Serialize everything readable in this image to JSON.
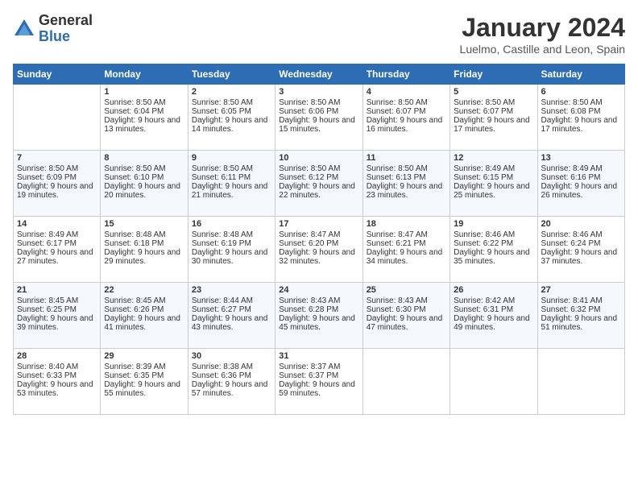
{
  "logo": {
    "general": "General",
    "blue": "Blue"
  },
  "title": "January 2024",
  "location": "Luelmo, Castille and Leon, Spain",
  "days": [
    "Sunday",
    "Monday",
    "Tuesday",
    "Wednesday",
    "Thursday",
    "Friday",
    "Saturday"
  ],
  "weeks": [
    [
      {
        "num": "",
        "data": []
      },
      {
        "num": "1",
        "sunrise": "Sunrise: 8:50 AM",
        "sunset": "Sunset: 6:04 PM",
        "daylight": "Daylight: 9 hours and 13 minutes."
      },
      {
        "num": "2",
        "sunrise": "Sunrise: 8:50 AM",
        "sunset": "Sunset: 6:05 PM",
        "daylight": "Daylight: 9 hours and 14 minutes."
      },
      {
        "num": "3",
        "sunrise": "Sunrise: 8:50 AM",
        "sunset": "Sunset: 6:06 PM",
        "daylight": "Daylight: 9 hours and 15 minutes."
      },
      {
        "num": "4",
        "sunrise": "Sunrise: 8:50 AM",
        "sunset": "Sunset: 6:07 PM",
        "daylight": "Daylight: 9 hours and 16 minutes."
      },
      {
        "num": "5",
        "sunrise": "Sunrise: 8:50 AM",
        "sunset": "Sunset: 6:07 PM",
        "daylight": "Daylight: 9 hours and 17 minutes."
      },
      {
        "num": "6",
        "sunrise": "Sunrise: 8:50 AM",
        "sunset": "Sunset: 6:08 PM",
        "daylight": "Daylight: 9 hours and 17 minutes."
      }
    ],
    [
      {
        "num": "7",
        "sunrise": "Sunrise: 8:50 AM",
        "sunset": "Sunset: 6:09 PM",
        "daylight": "Daylight: 9 hours and 19 minutes."
      },
      {
        "num": "8",
        "sunrise": "Sunrise: 8:50 AM",
        "sunset": "Sunset: 6:10 PM",
        "daylight": "Daylight: 9 hours and 20 minutes."
      },
      {
        "num": "9",
        "sunrise": "Sunrise: 8:50 AM",
        "sunset": "Sunset: 6:11 PM",
        "daylight": "Daylight: 9 hours and 21 minutes."
      },
      {
        "num": "10",
        "sunrise": "Sunrise: 8:50 AM",
        "sunset": "Sunset: 6:12 PM",
        "daylight": "Daylight: 9 hours and 22 minutes."
      },
      {
        "num": "11",
        "sunrise": "Sunrise: 8:50 AM",
        "sunset": "Sunset: 6:13 PM",
        "daylight": "Daylight: 9 hours and 23 minutes."
      },
      {
        "num": "12",
        "sunrise": "Sunrise: 8:49 AM",
        "sunset": "Sunset: 6:15 PM",
        "daylight": "Daylight: 9 hours and 25 minutes."
      },
      {
        "num": "13",
        "sunrise": "Sunrise: 8:49 AM",
        "sunset": "Sunset: 6:16 PM",
        "daylight": "Daylight: 9 hours and 26 minutes."
      }
    ],
    [
      {
        "num": "14",
        "sunrise": "Sunrise: 8:49 AM",
        "sunset": "Sunset: 6:17 PM",
        "daylight": "Daylight: 9 hours and 27 minutes."
      },
      {
        "num": "15",
        "sunrise": "Sunrise: 8:48 AM",
        "sunset": "Sunset: 6:18 PM",
        "daylight": "Daylight: 9 hours and 29 minutes."
      },
      {
        "num": "16",
        "sunrise": "Sunrise: 8:48 AM",
        "sunset": "Sunset: 6:19 PM",
        "daylight": "Daylight: 9 hours and 30 minutes."
      },
      {
        "num": "17",
        "sunrise": "Sunrise: 8:47 AM",
        "sunset": "Sunset: 6:20 PM",
        "daylight": "Daylight: 9 hours and 32 minutes."
      },
      {
        "num": "18",
        "sunrise": "Sunrise: 8:47 AM",
        "sunset": "Sunset: 6:21 PM",
        "daylight": "Daylight: 9 hours and 34 minutes."
      },
      {
        "num": "19",
        "sunrise": "Sunrise: 8:46 AM",
        "sunset": "Sunset: 6:22 PM",
        "daylight": "Daylight: 9 hours and 35 minutes."
      },
      {
        "num": "20",
        "sunrise": "Sunrise: 8:46 AM",
        "sunset": "Sunset: 6:24 PM",
        "daylight": "Daylight: 9 hours and 37 minutes."
      }
    ],
    [
      {
        "num": "21",
        "sunrise": "Sunrise: 8:45 AM",
        "sunset": "Sunset: 6:25 PM",
        "daylight": "Daylight: 9 hours and 39 minutes."
      },
      {
        "num": "22",
        "sunrise": "Sunrise: 8:45 AM",
        "sunset": "Sunset: 6:26 PM",
        "daylight": "Daylight: 9 hours and 41 minutes."
      },
      {
        "num": "23",
        "sunrise": "Sunrise: 8:44 AM",
        "sunset": "Sunset: 6:27 PM",
        "daylight": "Daylight: 9 hours and 43 minutes."
      },
      {
        "num": "24",
        "sunrise": "Sunrise: 8:43 AM",
        "sunset": "Sunset: 6:28 PM",
        "daylight": "Daylight: 9 hours and 45 minutes."
      },
      {
        "num": "25",
        "sunrise": "Sunrise: 8:43 AM",
        "sunset": "Sunset: 6:30 PM",
        "daylight": "Daylight: 9 hours and 47 minutes."
      },
      {
        "num": "26",
        "sunrise": "Sunrise: 8:42 AM",
        "sunset": "Sunset: 6:31 PM",
        "daylight": "Daylight: 9 hours and 49 minutes."
      },
      {
        "num": "27",
        "sunrise": "Sunrise: 8:41 AM",
        "sunset": "Sunset: 6:32 PM",
        "daylight": "Daylight: 9 hours and 51 minutes."
      }
    ],
    [
      {
        "num": "28",
        "sunrise": "Sunrise: 8:40 AM",
        "sunset": "Sunset: 6:33 PM",
        "daylight": "Daylight: 9 hours and 53 minutes."
      },
      {
        "num": "29",
        "sunrise": "Sunrise: 8:39 AM",
        "sunset": "Sunset: 6:35 PM",
        "daylight": "Daylight: 9 hours and 55 minutes."
      },
      {
        "num": "30",
        "sunrise": "Sunrise: 8:38 AM",
        "sunset": "Sunset: 6:36 PM",
        "daylight": "Daylight: 9 hours and 57 minutes."
      },
      {
        "num": "31",
        "sunrise": "Sunrise: 8:37 AM",
        "sunset": "Sunset: 6:37 PM",
        "daylight": "Daylight: 9 hours and 59 minutes."
      },
      {
        "num": "",
        "data": []
      },
      {
        "num": "",
        "data": []
      },
      {
        "num": "",
        "data": []
      }
    ]
  ]
}
